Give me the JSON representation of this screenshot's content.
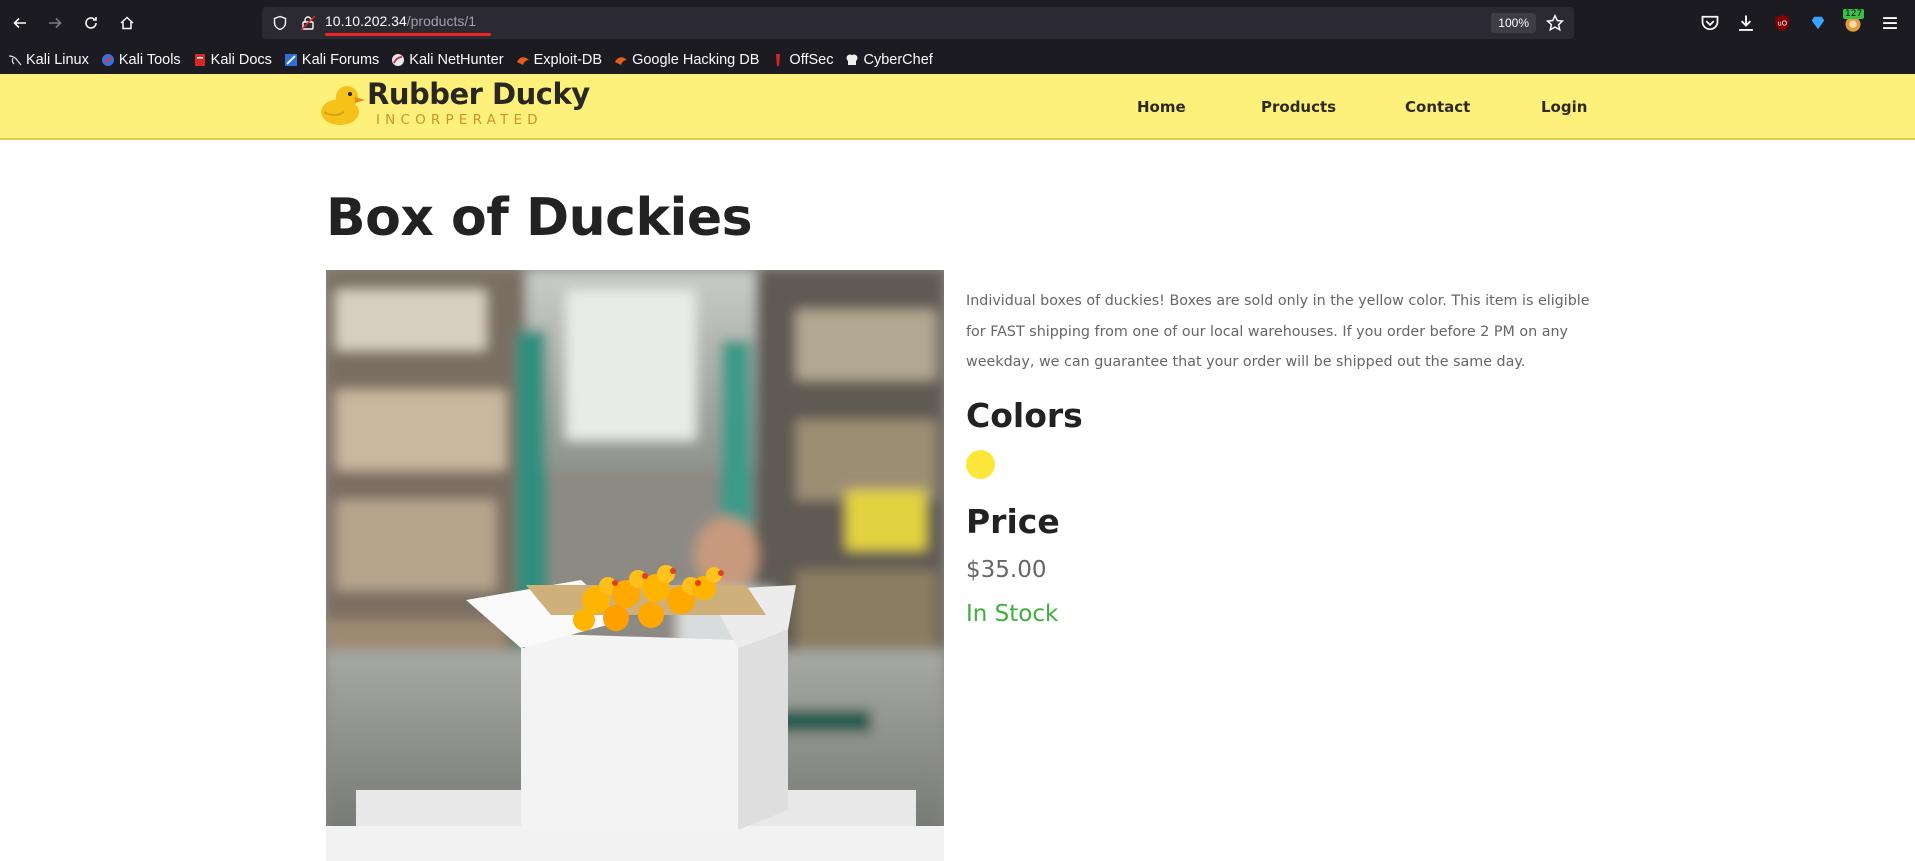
{
  "browser": {
    "url_host": "10.10.202.34",
    "url_path": "/products/1",
    "zoom": "100%",
    "badge_count": "127",
    "bookmarks": [
      {
        "label": "Kali Linux",
        "icon": "kali-dragon-icon"
      },
      {
        "label": "Kali Tools",
        "icon": "kali-tools-icon"
      },
      {
        "label": "Kali Docs",
        "icon": "kali-docs-icon"
      },
      {
        "label": "Kali Forums",
        "icon": "kali-forums-icon"
      },
      {
        "label": "Kali NetHunter",
        "icon": "kali-nethunter-icon"
      },
      {
        "label": "Exploit-DB",
        "icon": "exploit-db-icon"
      },
      {
        "label": "Google Hacking DB",
        "icon": "ghdb-icon"
      },
      {
        "label": "OffSec",
        "icon": "offsec-icon"
      },
      {
        "label": "CyberChef",
        "icon": "cyberchef-icon"
      }
    ]
  },
  "site": {
    "logo_title": "Rubber Ducky",
    "logo_subtitle": "INCORPERATED",
    "nav": [
      "Home",
      "Products",
      "Contact",
      "Login"
    ]
  },
  "product": {
    "title": "Box of Duckies",
    "description": "Individual boxes of duckies! Boxes are sold only in the yellow color. This item is eligible for FAST shipping from one of our local warehouses. If you order before 2 PM on any weekday, we can guarantee that your order will be shipped out the same day.",
    "colors_heading": "Colors",
    "colors": [
      "#fde63a"
    ],
    "price_heading": "Price",
    "price": "$35.00",
    "stock_status": "In Stock",
    "stock_color": "#3fae3f"
  }
}
